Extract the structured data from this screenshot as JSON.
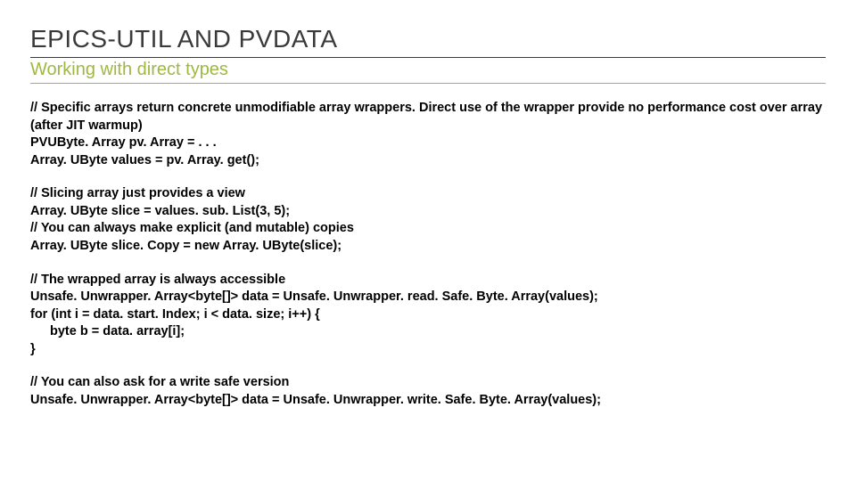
{
  "title": "EPICS-UTIL AND PVDATA",
  "subtitle": "Working with direct types",
  "block1": {
    "c1": "// Specific arrays return concrete unmodifiable array wrappers. Direct use of the wrapper provide no performance cost over array (after JIT warmup)",
    "l1": "PVUByte. Array pv. Array = . . .",
    "l2": "Array. UByte values = pv. Array. get();"
  },
  "block2": {
    "c1": "// Slicing array just provides a view",
    "l1": "Array. UByte slice = values. sub. List(3, 5);",
    "c2": "// You can always make explicit (and mutable) copies",
    "l2": "Array. UByte slice. Copy = new Array. UByte(slice);"
  },
  "block3": {
    "c1": "// The wrapped array is always accessible",
    "l1": "Unsafe. Unwrapper. Array<byte[]> data = Unsafe. Unwrapper. read. Safe. Byte. Array(values);",
    "l2": "for (int i = data. start. Index; i < data. size; i++) {",
    "l3": "byte b = data. array[i];",
    "l4": "}"
  },
  "block4": {
    "c1": "// You can also ask for a write safe version",
    "l1": "Unsafe. Unwrapper. Array<byte[]> data = Unsafe. Unwrapper. write. Safe. Byte. Array(values);"
  }
}
